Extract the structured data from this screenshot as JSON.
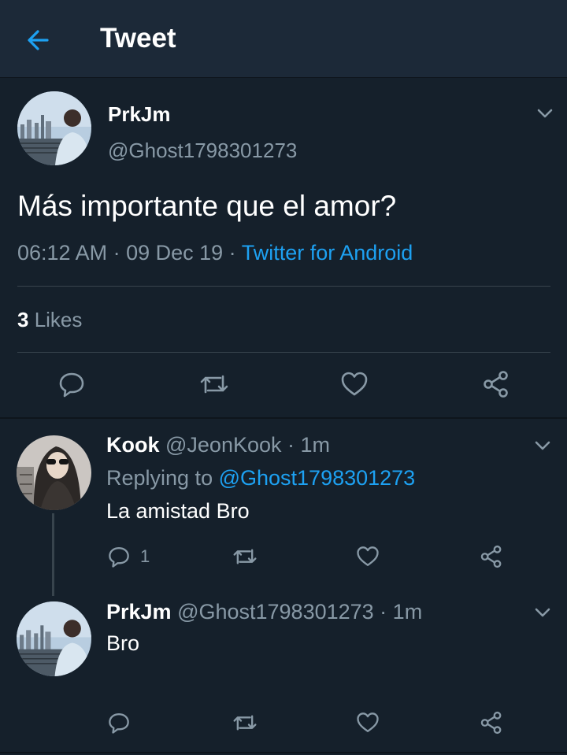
{
  "header": {
    "title": "Tweet",
    "back_icon": "arrow-left-icon"
  },
  "colors": {
    "background": "#15202b",
    "header": "#1c2938",
    "accent": "#1da1f2",
    "muted": "#8899a6",
    "divider": "#38444d"
  },
  "tweet": {
    "name": "PrkJm",
    "handle": "@Ghost1798301273",
    "text": "Más importante que el amor?",
    "time": "06:12 AM",
    "sep1": " · ",
    "date": "09 Dec 19",
    "sep2": " · ",
    "source": "Twitter for Android",
    "likes_count": "3",
    "likes_label": " Likes"
  },
  "replies": [
    {
      "name": "Kook",
      "handle": " @JeonKook",
      "dot": " · ",
      "time": "1m",
      "replying_label": "Replying to ",
      "replying_to": "@Ghost1798301273",
      "text": "La amistad Bro",
      "reply_count": "1"
    },
    {
      "name": "PrkJm",
      "handle": " @Ghost1798301273",
      "dot": " · ",
      "time": "1m",
      "text": "Bro"
    }
  ],
  "icons": [
    "reply-icon",
    "retweet-icon",
    "heart-icon",
    "share-icon",
    "chevron-down-icon"
  ]
}
